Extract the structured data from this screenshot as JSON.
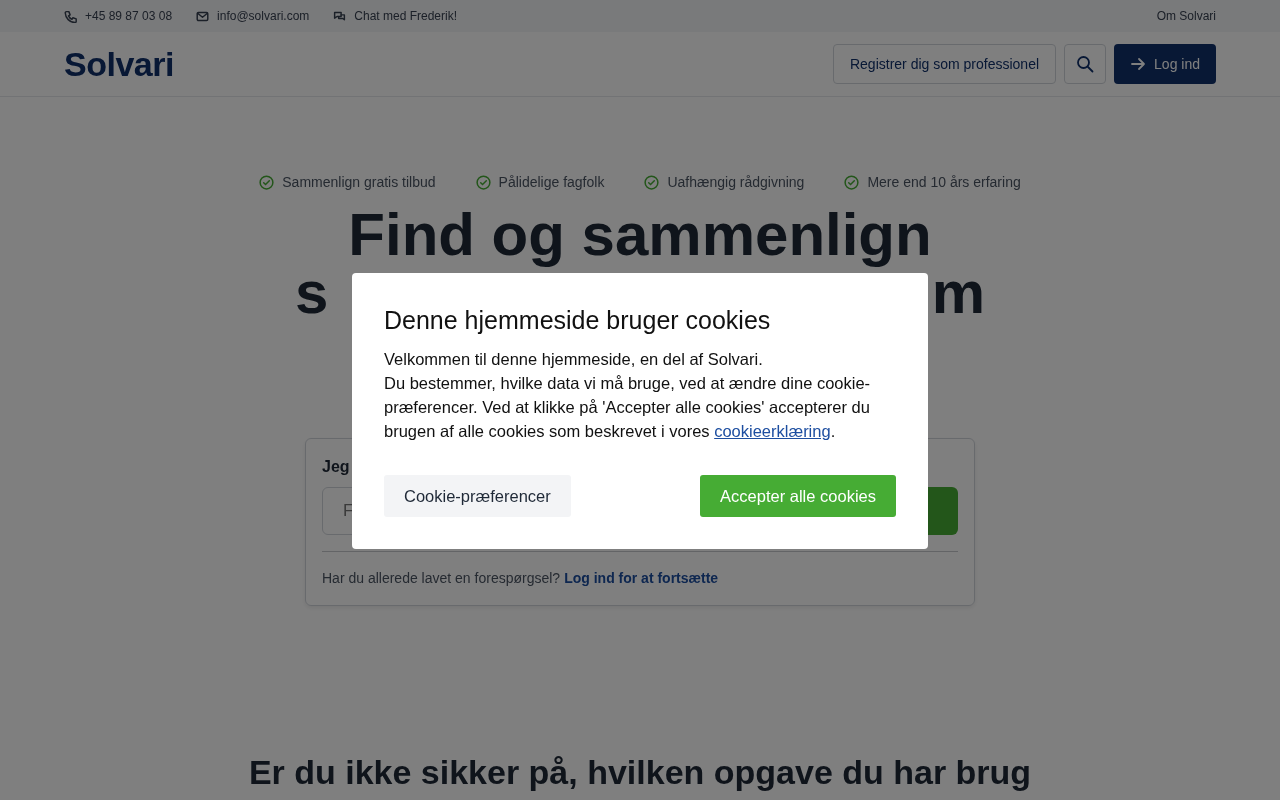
{
  "topbar": {
    "contacts": [
      {
        "kind": "phone",
        "text": "+45 89 87 03 08"
      },
      {
        "kind": "mail",
        "text": "info@solvari.com"
      },
      {
        "kind": "chat",
        "text": "Chat med Frederik!"
      }
    ],
    "right_link": "Om Solvari"
  },
  "header": {
    "logo": "Solvari",
    "register_button": "Registrer dig som professionel",
    "login_button": "Log ind"
  },
  "benefits": [
    "Sammenlign gratis tilbud",
    "Pålidelige fagfolk",
    "Uafhængig rådgivning",
    "Mere end 10 års erfaring"
  ],
  "hero": {
    "title_line": "Find og sammenlign",
    "title_fragments": [
      "s",
      "m"
    ]
  },
  "search_card": {
    "label": "Jeg",
    "placeholder": "F",
    "footer_text": "Har du allerede lavet en forespørgsel?",
    "footer_link": "Log ind for at fortsætte"
  },
  "section_heading": "Er du ikke sikker på, hvilken opgave du har brug",
  "cookie_modal": {
    "title": "Denne hjemmeside bruger cookies",
    "intro": "Velkommen til denne hjemmeside, en del af Solvari.",
    "body": "Du bestemmer, hvilke data vi må bruge, ved at ændre dine cookie-præferencer. Ved at klikke på 'Accepter alle cookies' accepterer du brugen af alle cookies som beskrevet i vores",
    "link": "cookieerklæring",
    "after_link": ".",
    "buttons": [
      {
        "kind": "secondary",
        "label": "Cookie-præferencer"
      },
      {
        "kind": "primary",
        "label": "Accepter alle cookies"
      }
    ]
  }
}
